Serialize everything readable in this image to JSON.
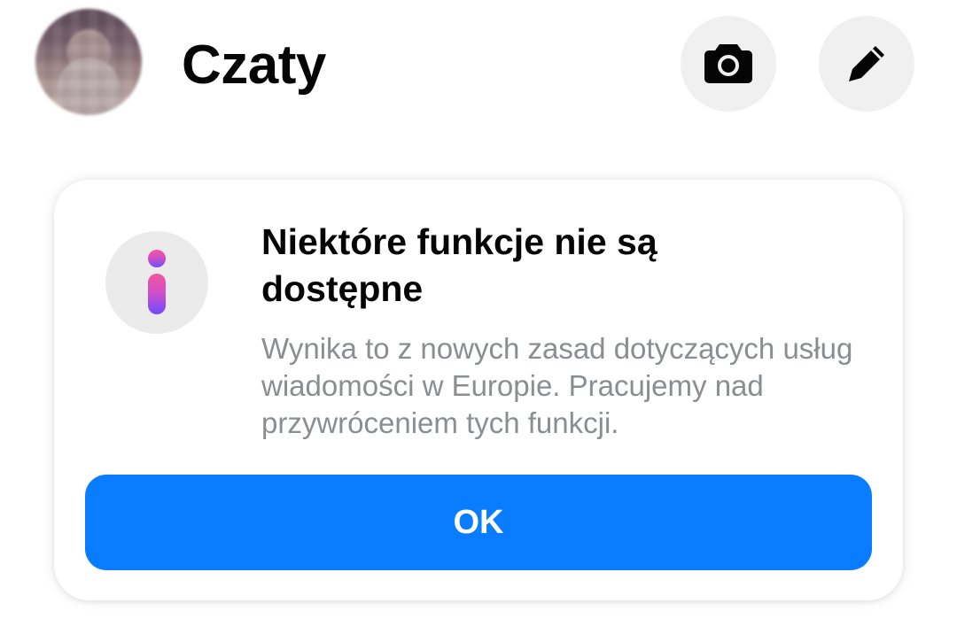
{
  "header": {
    "title": "Czaty",
    "avatar_icon": "profile-avatar",
    "camera_icon": "camera-icon",
    "edit_icon": "pencil-icon"
  },
  "notice": {
    "icon": "info-icon",
    "title": "Niektóre funkcje nie są dostępne",
    "body": "Wynika to z nowych zasad dotyczących usług wiadomości w Europie. Pracujemy nad przywróceniem tych funkcji.",
    "ok_label": "OK"
  },
  "colors": {
    "accent": "#0a7cff",
    "body_text": "#8a8d91",
    "icon_button_bg": "#f0f0f0",
    "info_gradient_top": "#e74fa8",
    "info_gradient_bottom": "#7b4dff"
  }
}
